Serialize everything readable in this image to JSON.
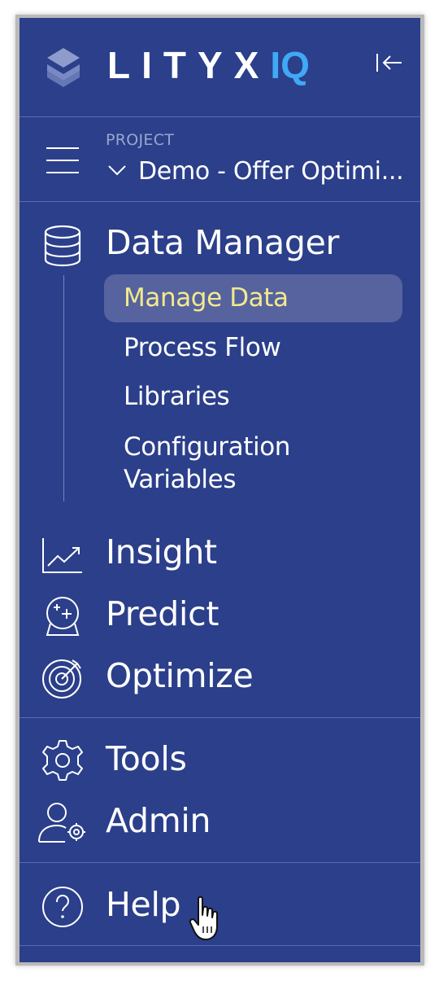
{
  "header": {
    "logo_text": "LITYXIQ",
    "collapse_icon": "collapse-left-icon"
  },
  "project": {
    "label": "PROJECT",
    "name": "Demo - Offer Optimi..."
  },
  "nav": {
    "data_manager": {
      "label": "Data Manager",
      "icon": "database-icon",
      "items": [
        {
          "label": "Manage Data",
          "active": true
        },
        {
          "label": "Process Flow"
        },
        {
          "label": "Libraries"
        },
        {
          "label": "Configuration\nVariables"
        }
      ]
    },
    "insight": {
      "label": "Insight",
      "icon": "chart-trend-icon"
    },
    "predict": {
      "label": "Predict",
      "icon": "crystal-ball-icon"
    },
    "optimize": {
      "label": "Optimize",
      "icon": "target-icon"
    },
    "tools": {
      "label": "Tools",
      "icon": "gear-icon"
    },
    "admin": {
      "label": "Admin",
      "icon": "user-gear-icon"
    },
    "help": {
      "label": "Help",
      "icon": "question-circle-icon"
    }
  },
  "colors": {
    "panel_bg": "#2b3f8a",
    "active_bg": "#56639f",
    "active_text": "#f3e98e",
    "logo_accent": "#3fa9f5"
  }
}
